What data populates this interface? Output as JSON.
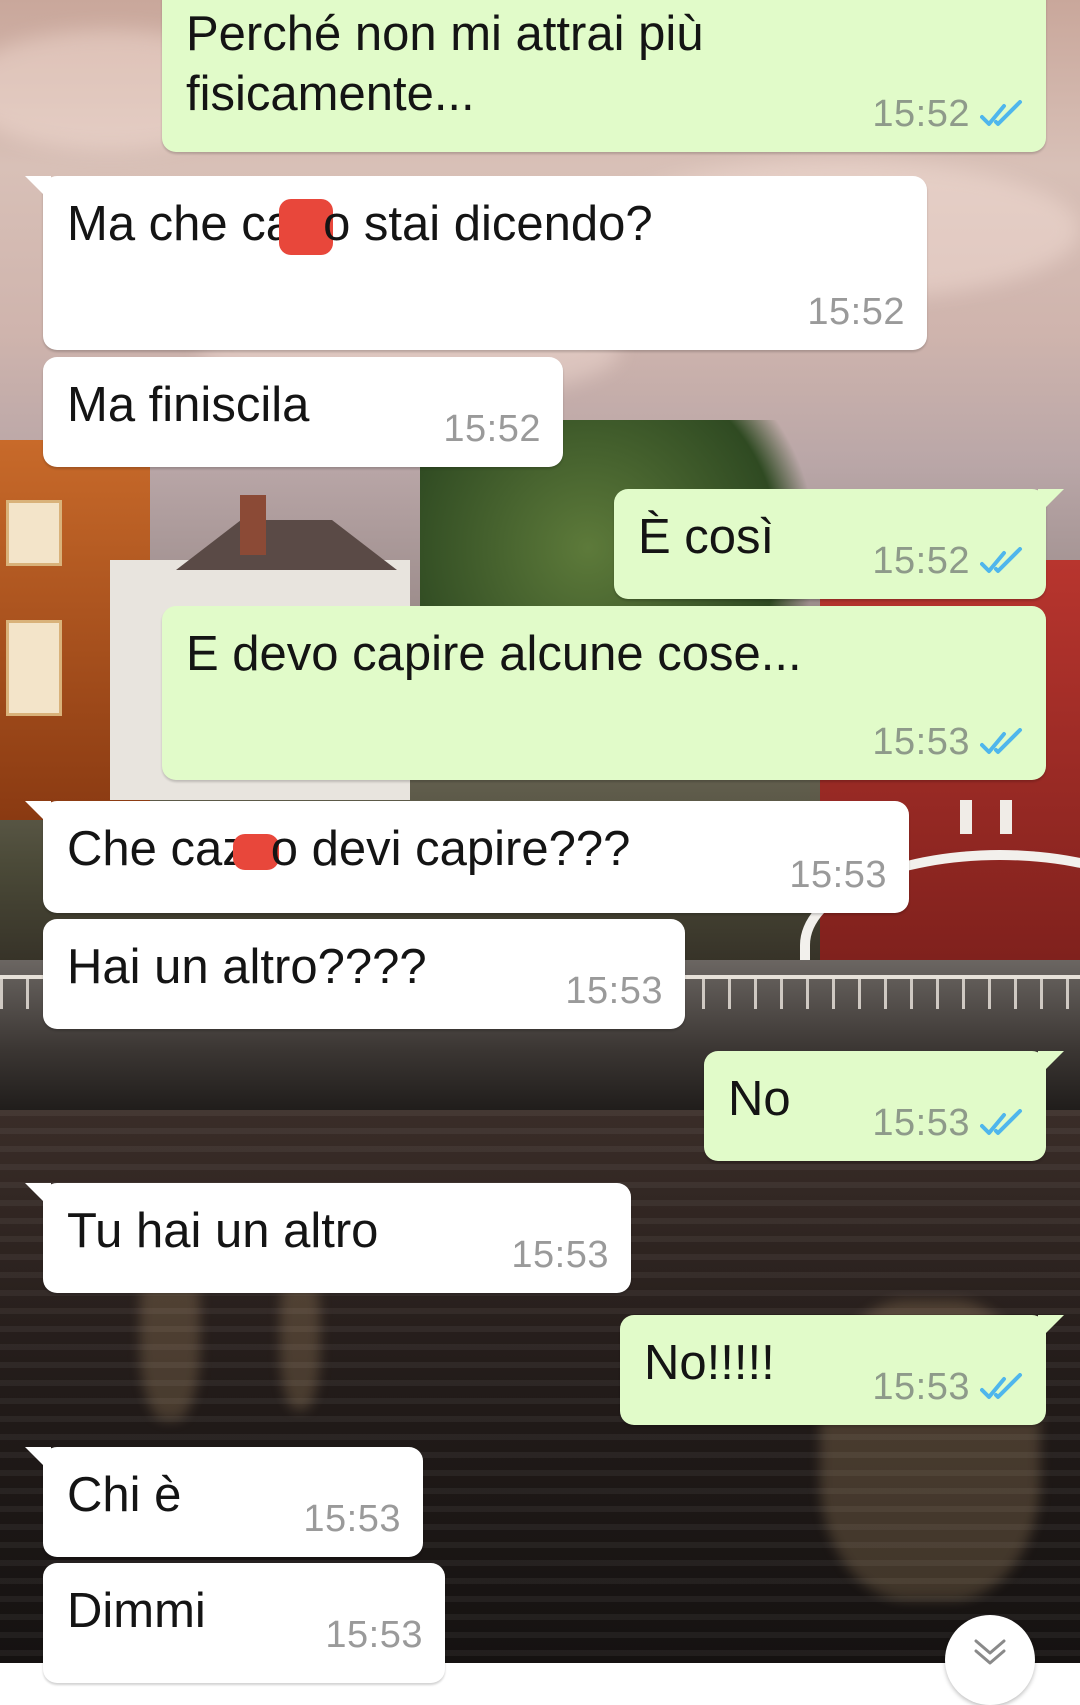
{
  "conversation": {
    "messages": [
      {
        "id": "m1",
        "dir": "out",
        "text": "Perché non mi attrai più\nfisicamente...",
        "time": "15:52",
        "status": "read"
      },
      {
        "id": "m2",
        "dir": "in",
        "text_before": "Ma che ca",
        "text_after": "o stai dicendo?",
        "redacted": true,
        "time": "15:52"
      },
      {
        "id": "m3",
        "dir": "in",
        "text": "Ma finiscila",
        "time": "15:52"
      },
      {
        "id": "m4",
        "dir": "out",
        "text": "È così",
        "time": "15:52",
        "status": "read"
      },
      {
        "id": "m5",
        "dir": "out",
        "text": "E devo capire alcune cose...",
        "time": "15:53",
        "status": "read"
      },
      {
        "id": "m6",
        "dir": "in",
        "text_before": "Che caz",
        "text_after": "o devi capire???",
        "redacted": true,
        "time": "15:53"
      },
      {
        "id": "m7",
        "dir": "in",
        "text": "Hai un altro????",
        "time": "15:53"
      },
      {
        "id": "m8",
        "dir": "out",
        "text": "No",
        "time": "15:53",
        "status": "read"
      },
      {
        "id": "m9",
        "dir": "in",
        "text": "Tu hai un altro",
        "time": "15:53"
      },
      {
        "id": "m10",
        "dir": "out",
        "text": "No!!!!!",
        "time": "15:53",
        "status": "read"
      },
      {
        "id": "m11",
        "dir": "in",
        "text": "Chi è",
        "time": "15:53"
      },
      {
        "id": "m12",
        "dir": "in",
        "text": "Dimmi",
        "time": "15:53"
      }
    ]
  },
  "colors": {
    "outgoing_bubble": "#e1fbc9",
    "incoming_bubble": "#ffffff",
    "read_tick": "#4fb6ec",
    "redaction": "#e8473b"
  },
  "icons": {
    "read_receipt": "double-check-icon",
    "scroll_down": "chevron-double-down-icon"
  }
}
